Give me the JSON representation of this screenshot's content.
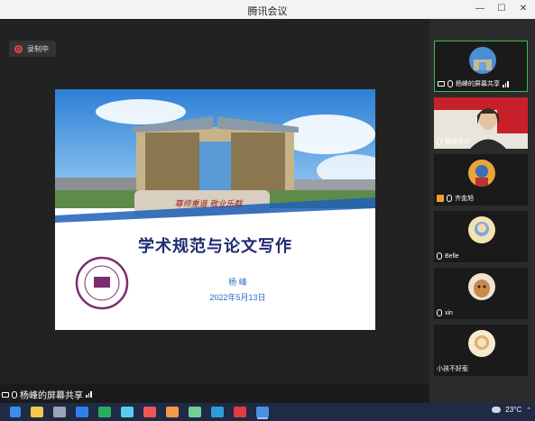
{
  "window": {
    "title": "腾讯会议"
  },
  "recording": {
    "label": "录制中",
    "icon": "record-icon"
  },
  "slide": {
    "title": "学术规范与论文写作",
    "author": "杨 峰",
    "date": "2022年5月13日",
    "calligraphy": "尊师重道 敬业乐群"
  },
  "screen_share": {
    "label": "杨峰的屏幕共享"
  },
  "participants": [
    {
      "name": "杨峰的屏幕共享",
      "active": true,
      "avatar": "building-photo"
    },
    {
      "name": "珊瑚子曰",
      "active": false,
      "avatar": "person-video"
    },
    {
      "name": "齐金旭",
      "active": false,
      "avatar": "cartoon-avatar"
    },
    {
      "name": "Belle",
      "active": false,
      "avatar": "cartoon-avatar"
    },
    {
      "name": "xin",
      "active": false,
      "avatar": "dog-avatar"
    },
    {
      "name": "小孩不好惹",
      "active": false,
      "avatar": "cartoon-avatar"
    }
  ],
  "taskbar": {
    "temperature": "23°C",
    "apps": [
      "start-icon",
      "explorer-icon",
      "browser-icon",
      "mail-icon",
      "wechat-icon",
      "browser-icon",
      "office-icon",
      "photo-icon",
      "terminal-icon",
      "wps-icon",
      "meeting-icon"
    ]
  },
  "colors": {
    "accent_green": "#3fb950",
    "record_red": "#e54646",
    "title_navy": "#1e2a6e",
    "text_blue": "#2a6ac6"
  }
}
